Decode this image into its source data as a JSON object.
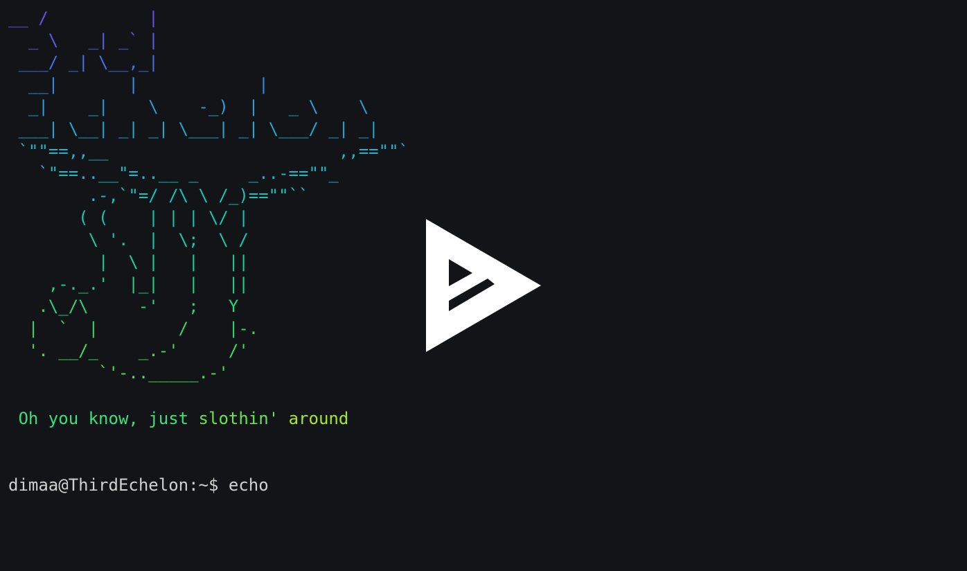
{
  "theme": {
    "background": "#121417",
    "foreground": "#d0d0d0",
    "play_button_color": "#ffffff"
  },
  "ascii_art": [
    {
      "text": "__ /          |",
      "color": "#6b4fe8"
    },
    {
      "text": "  _ \\   _| _` |",
      "color": "#5a5fe8"
    },
    {
      "text": " ___/ _| \\__,_|",
      "color": "#4a6fe8"
    },
    {
      "text": "  __|       |            |",
      "color": "#2f8fe0"
    },
    {
      "text": "  _|    _|    \\    -_)  |   _ \\    \\",
      "color": "#2a9fd8"
    },
    {
      "text": " ___| \\__| _| _| \\___| _| \\___/ _| _|",
      "color": "#22a9d4"
    },
    {
      "text": " `\"\"==,,__                       ,,==\"\"`",
      "color": "#1db4d0"
    },
    {
      "text": "   `\"==..__\"=..__ _     _..-==\"\"_",
      "color": "#19bcc8"
    },
    {
      "text": "        .-,`\"=/ /\\ \\ /_)==\"\"``",
      "color": "#16c4bc"
    },
    {
      "text": "       ( (    | | | \\/ |",
      "color": "#15c8b0"
    },
    {
      "text": "        \\ '.  |  \\;  \\ /",
      "color": "#18cba4"
    },
    {
      "text": "         |  \\ |   |   ||",
      "color": "#1ccf98"
    },
    {
      "text": "    ,-._.'  |_|   |   ||",
      "color": "#22d28a"
    },
    {
      "text": "   .\\_/\\     -'   ;   Y",
      "color": "#2ad57c"
    },
    {
      "text": "  |  `  |        /    |-.",
      "color": "#34d86e"
    },
    {
      "text": "  '. __/_    _.-'     /'",
      "color": "#40db60"
    },
    {
      "text": "         `'-.._____.-'",
      "color": "#4cdd54"
    }
  ],
  "tagline": {
    "segments": [
      {
        "text": " Oh you know, just ",
        "color": "#3be07a"
      },
      {
        "text": "slothin' ",
        "color": "#62e64a"
      },
      {
        "text": "around",
        "color": "#a8e62a"
      }
    ]
  },
  "prompt": {
    "user_host": "dimaa@ThirdEchelon",
    "path": ":~$ ",
    "command": "echo"
  },
  "play_button": {
    "icon": "asciinema-play-icon"
  }
}
